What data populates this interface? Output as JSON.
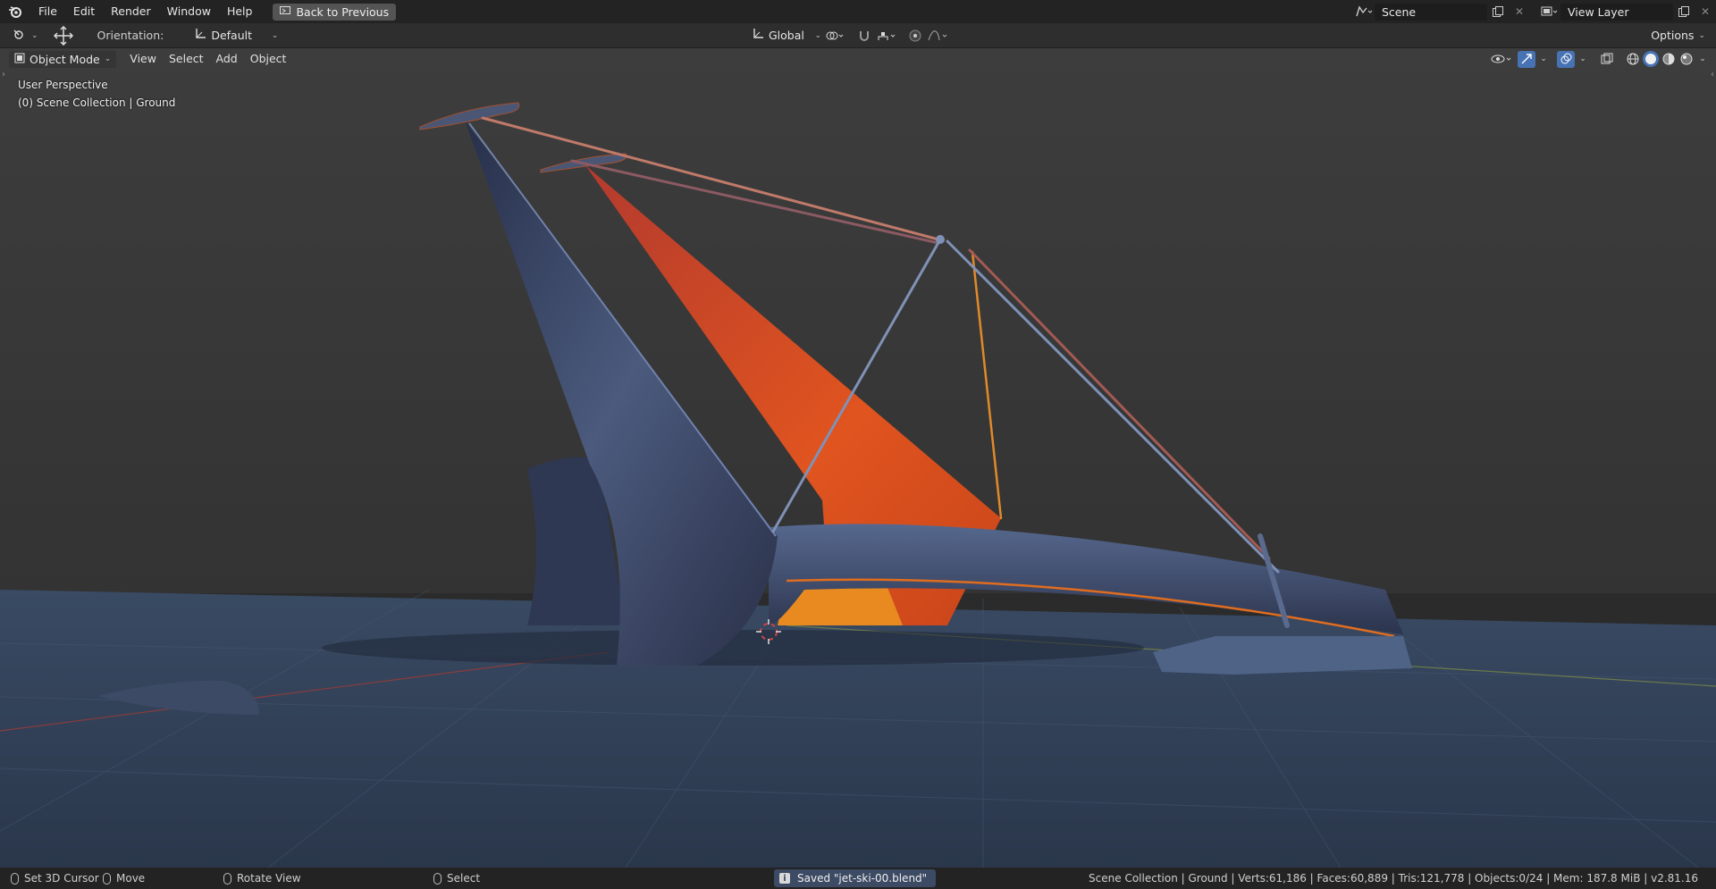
{
  "topbar": {
    "menus": [
      "File",
      "Edit",
      "Render",
      "Window",
      "Help"
    ],
    "back_button": "Back to Previous",
    "scene": "Scene",
    "view_layer": "View Layer"
  },
  "toolbar": {
    "orientation_label": "Orientation:",
    "orientation_value": "Default",
    "transform_space": "Global",
    "options": "Options"
  },
  "viewport_header": {
    "mode": "Object Mode",
    "menus": [
      "View",
      "Select",
      "Add",
      "Object"
    ]
  },
  "viewport": {
    "perspective": "User Perspective",
    "collection": "(0) Scene Collection | Ground"
  },
  "statusbar": {
    "set_cursor": "Set 3D Cursor",
    "move": "Move",
    "rotate": "Rotate View",
    "select": "Select",
    "saved_message": "Saved \"jet-ski-00.blend\"",
    "stats": "Scene Collection | Ground | Verts:61,186 | Faces:60,889 | Tris:121,778 | Objects:0/24 | Mem: 187.8 MiB | v2.81.16"
  },
  "colors": {
    "accent_orange": "#e0541f",
    "body_blue": "#3e4a66",
    "ground": "#2d3c52",
    "sky": "#3a3a3a"
  }
}
